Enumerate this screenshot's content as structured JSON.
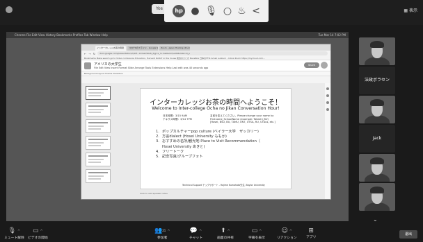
{
  "top_bar": {
    "share_pill": "Yos",
    "view_label": "表示",
    "toolbar_logo": "hp"
  },
  "browser": {
    "tabs": [
      "インターカレッジお茶の時間",
      "コロナ6のスライド - Google Slides",
      "Zoom - Japan Hosting (Zoom)"
    ],
    "url": "docs.google.com/presentation/d/1M...IcnGenSKu6_Xjg=s_m-mail&oml/edit#slide=id_p",
    "bookmarks": "Bookmarks  Make search go to  Video conference  Education, Harvard  RoBoT in the house  和食のさとか  BaneBox 日本のFFIS  Gmail  sunburn - Inbox Zoom  https://mycloud.com...",
    "doc_title": "アメリカの大学生",
    "doc_menu": "File  Edit  View  Insert  Format  Slide  Arrange  Tools  Extensions  Help  Last edit was 40 seconds ago",
    "share_label": "Share",
    "toolbar": "Background   Layout   Theme   Transition",
    "speaker_notes": "Click to add speaker notes"
  },
  "slide": {
    "title_jp": "インターカレッジお茶の時間へようこそ！",
    "title_en": "Welcome to Inter-college Ocha no Jikan Conversation Hour!",
    "jp_time": "日本時間：3/15 9AM",
    "tx_time": "テキサス時間：3/14 7PM",
    "name_note": [
      "名前を変えてください。Please change your name to:",
      "Firstname_SchoolName (example: Takeshi_BU)",
      "[Hosei, BSU, BU, TAMU, UNT, UTSA, RU, UTAus, etc.]"
    ],
    "agenda": [
      {
        "num": "1.",
        "text": "ポップカルチャーpop culture (ベイラー大学　ザッカリー)"
      },
      {
        "num": "2.",
        "text": "方言dialect (Hosei University ももか)"
      },
      {
        "num": "3.",
        "text": "おすすめの名所/観光地 Place to Visit Recommendation（"
      },
      {
        "num": "",
        "text": "Hosei University あきと)"
      },
      {
        "num": "4.",
        "text": "フリートーク"
      },
      {
        "num": "5.",
        "text": "記念写真/グループフォト"
      }
    ],
    "support": "Technical Support テックサポート - Hajime Kumahata先生, Baylor University"
  },
  "participants": [
    {
      "type": "video"
    },
    {
      "type": "name",
      "name": "法政ボラセン"
    },
    {
      "type": "video"
    },
    {
      "type": "name",
      "name": "Jack"
    },
    {
      "type": "video"
    },
    {
      "type": "video"
    }
  ],
  "bottom_bar": {
    "mute": "ミュート解除",
    "video": "ビデオの開始",
    "participants": "参加者",
    "participants_count": "21",
    "chat": "チャット",
    "share": "画面の共有",
    "captions": "字幕を表示",
    "reactions": "リアクション",
    "apps": "アプリ",
    "leave": "退出"
  },
  "colors": {
    "background": "#1a1a1a",
    "slide_bg": "#ffffff",
    "toolbar_bg": "#f1f1f1"
  }
}
